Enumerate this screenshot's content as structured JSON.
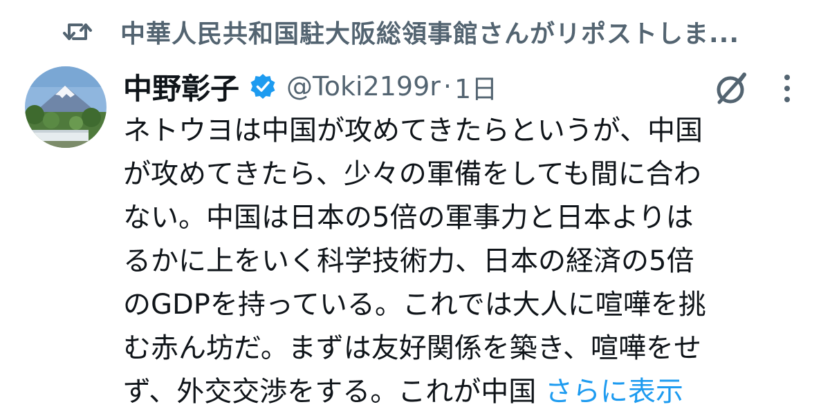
{
  "repost": {
    "icon": "repost-icon",
    "text": "中華人民共和国駐大阪総領事館さんがリポストしま..."
  },
  "author": {
    "display_name": "中野彰子",
    "verified": true,
    "handle": "@Toki2199r",
    "separator": "·",
    "time": "1日"
  },
  "tweet": {
    "lines": [
      "ネトウヨは中国が攻めてきたらというが、中国",
      "が攻めてきたら、少々の軍備をしても間に合わ",
      "ない。中国は日本の5倍の軍事力と日本よりは",
      "るかに上をいく科学技術力、日本の経済の5倍",
      "のGDPを持っている。これでは大人に喧嘩を挑",
      "む赤ん坊だ。まずは友好関係を築き、喧嘩をせ",
      "ず、外交交渉をする。これが中国 "
    ],
    "show_more": "さらに表示"
  },
  "icons": {
    "grok": "grok-icon",
    "more": "more-icon",
    "verified": "verified-badge-icon"
  },
  "colors": {
    "accent": "#1d9bf0",
    "secondary_text": "#536471",
    "primary_text": "#0f1419"
  }
}
